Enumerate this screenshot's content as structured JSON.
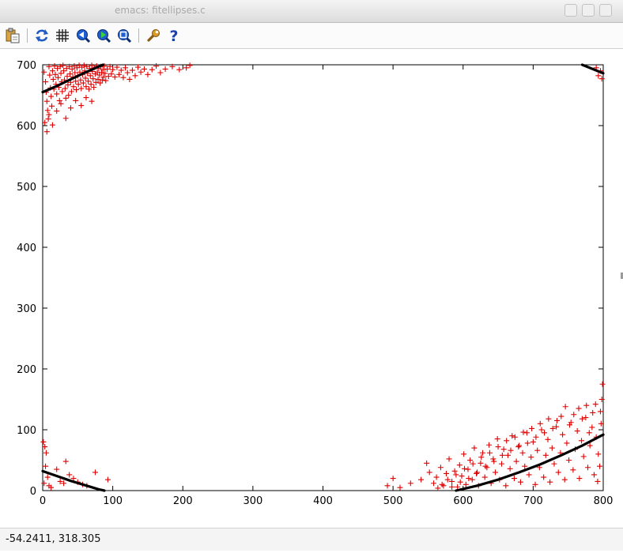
{
  "window": {
    "title": "emacs: fitellipses.c"
  },
  "toolbar": {
    "buttons": [
      {
        "icon": "copy-to-clipboard-icon",
        "label": "Copy to clipboard"
      },
      {
        "icon": "replot-icon",
        "label": "Replot"
      },
      {
        "icon": "grid-icon",
        "label": "Grid"
      },
      {
        "icon": "previous-zoom-icon",
        "label": "Previous zoom"
      },
      {
        "icon": "next-zoom-icon",
        "label": "Next zoom"
      },
      {
        "icon": "autoscale-icon",
        "label": "Autoscale"
      },
      {
        "icon": "settings-wrench-icon",
        "label": "Settings"
      },
      {
        "icon": "help-icon",
        "label": "Help"
      }
    ]
  },
  "status": {
    "readout": "-54.2411,  318.305"
  },
  "colors": {
    "points": "#e00000",
    "curves": "#000000",
    "axes": "#000000"
  },
  "chart_data": {
    "type": "scatter",
    "title": "",
    "xlabel": "",
    "ylabel": "",
    "xlim": [
      0,
      800
    ],
    "ylim": [
      0,
      700
    ],
    "xticks": [
      0,
      100,
      200,
      300,
      400,
      500,
      600,
      700,
      800
    ],
    "yticks": [
      0,
      100,
      200,
      300,
      400,
      500,
      600,
      700
    ],
    "grid": false,
    "legend": "none",
    "series": [
      {
        "marker": "+",
        "color": "#e00000",
        "points": [
          [
            2,
            688
          ],
          [
            4,
            672
          ],
          [
            5,
            655
          ],
          [
            6,
            640
          ],
          [
            7,
            625
          ],
          [
            8,
            611
          ],
          [
            9,
            697
          ],
          [
            10,
            683
          ],
          [
            11,
            662
          ],
          [
            12,
            648
          ],
          [
            13,
            632
          ],
          [
            14,
            690
          ],
          [
            15,
            676
          ],
          [
            16,
            660
          ],
          [
            17,
            698
          ],
          [
            18,
            684
          ],
          [
            19,
            668
          ],
          [
            20,
            652
          ],
          [
            21,
            694
          ],
          [
            22,
            679
          ],
          [
            23,
            663
          ],
          [
            24,
            641
          ],
          [
            25,
            697
          ],
          [
            26,
            686
          ],
          [
            27,
            672
          ],
          [
            28,
            656
          ],
          [
            29,
            699
          ],
          [
            30,
            690
          ],
          [
            31,
            675
          ],
          [
            32,
            661
          ],
          [
            33,
            645
          ],
          [
            34,
            694
          ],
          [
            35,
            681
          ],
          [
            36,
            667
          ],
          [
            37,
            650
          ],
          [
            38,
            697
          ],
          [
            39,
            685
          ],
          [
            40,
            671
          ],
          [
            41,
            656
          ],
          [
            42,
            693
          ],
          [
            43,
            680
          ],
          [
            44,
            664
          ],
          [
            45,
            698
          ],
          [
            46,
            687
          ],
          [
            47,
            673
          ],
          [
            48,
            659
          ],
          [
            49,
            695
          ],
          [
            50,
            682
          ],
          [
            51,
            668
          ],
          [
            52,
            699
          ],
          [
            53,
            688
          ],
          [
            54,
            675
          ],
          [
            55,
            661
          ],
          [
            56,
            696
          ],
          [
            57,
            684
          ],
          [
            58,
            670
          ],
          [
            59,
            699
          ],
          [
            60,
            690
          ],
          [
            61,
            678
          ],
          [
            62,
            664
          ],
          [
            63,
            697
          ],
          [
            64,
            686
          ],
          [
            65,
            673
          ],
          [
            66,
            660
          ],
          [
            67,
            694
          ],
          [
            68,
            682
          ],
          [
            69,
            668
          ],
          [
            70,
            699
          ],
          [
            71,
            689
          ],
          [
            72,
            677
          ],
          [
            73,
            663
          ],
          [
            74,
            696
          ],
          [
            75,
            685
          ],
          [
            76,
            671
          ],
          [
            77,
            698
          ],
          [
            78,
            688
          ],
          [
            79,
            676
          ],
          [
            80,
            694
          ],
          [
            81,
            683
          ],
          [
            82,
            670
          ],
          [
            83,
            697
          ],
          [
            84,
            687
          ],
          [
            85,
            675
          ],
          [
            86,
            692
          ],
          [
            87,
            680
          ],
          [
            88,
            698
          ],
          [
            89,
            686
          ],
          [
            90,
            674
          ],
          [
            92,
            693
          ],
          [
            94,
            681
          ],
          [
            96,
            697
          ],
          [
            98,
            685
          ],
          [
            100,
            692
          ],
          [
            103,
            680
          ],
          [
            106,
            696
          ],
          [
            109,
            684
          ],
          [
            112,
            691
          ],
          [
            115,
            679
          ],
          [
            118,
            695
          ],
          [
            121,
            687
          ],
          [
            124,
            676
          ],
          [
            128,
            691
          ],
          [
            132,
            682
          ],
          [
            136,
            696
          ],
          [
            140,
            688
          ],
          [
            145,
            693
          ],
          [
            150,
            684
          ],
          [
            156,
            692
          ],
          [
            162,
            698
          ],
          [
            168,
            687
          ],
          [
            175,
            693
          ],
          [
            185,
            697
          ],
          [
            195,
            692
          ],
          [
            205,
            695
          ],
          [
            210,
            699
          ],
          [
            3,
            605
          ],
          [
            6,
            590
          ],
          [
            9,
            618
          ],
          [
            14,
            601
          ],
          [
            20,
            624
          ],
          [
            26,
            636
          ],
          [
            33,
            612
          ],
          [
            40,
            629
          ],
          [
            47,
            641
          ],
          [
            55,
            633
          ],
          [
            62,
            646
          ],
          [
            70,
            640
          ],
          [
            1,
            80
          ],
          [
            3,
            72
          ],
          [
            5,
            62
          ],
          [
            4,
            40
          ],
          [
            7,
            22
          ],
          [
            2,
            12
          ],
          [
            9,
            8
          ],
          [
            12,
            5
          ],
          [
            20,
            35
          ],
          [
            25,
            15
          ],
          [
            30,
            12
          ],
          [
            33,
            48
          ],
          [
            38,
            26
          ],
          [
            44,
            20
          ],
          [
            50,
            14
          ],
          [
            57,
            10
          ],
          [
            63,
            8
          ],
          [
            75,
            30
          ],
          [
            93,
            18
          ],
          [
            492,
            8
          ],
          [
            500,
            20
          ],
          [
            510,
            5
          ],
          [
            525,
            12
          ],
          [
            540,
            18
          ],
          [
            548,
            45
          ],
          [
            552,
            30
          ],
          [
            558,
            12
          ],
          [
            562,
            22
          ],
          [
            568,
            38
          ],
          [
            572,
            8
          ],
          [
            576,
            28
          ],
          [
            580,
            52
          ],
          [
            584,
            15
          ],
          [
            588,
            32
          ],
          [
            592,
            6
          ],
          [
            595,
            42
          ],
          [
            598,
            24
          ],
          [
            601,
            60
          ],
          [
            604,
            10
          ],
          [
            607,
            35
          ],
          [
            610,
            50
          ],
          [
            613,
            18
          ],
          [
            616,
            70
          ],
          [
            619,
            28
          ],
          [
            622,
            8
          ],
          [
            625,
            45
          ],
          [
            628,
            62
          ],
          [
            631,
            22
          ],
          [
            634,
            38
          ],
          [
            637,
            75
          ],
          [
            640,
            12
          ],
          [
            643,
            52
          ],
          [
            646,
            30
          ],
          [
            649,
            85
          ],
          [
            652,
            18
          ],
          [
            655,
            44
          ],
          [
            658,
            68
          ],
          [
            661,
            8
          ],
          [
            664,
            58
          ],
          [
            667,
            36
          ],
          [
            670,
            90
          ],
          [
            673,
            20
          ],
          [
            676,
            48
          ],
          [
            679,
            72
          ],
          [
            682,
            14
          ],
          [
            685,
            62
          ],
          [
            688,
            40
          ],
          [
            691,
            95
          ],
          [
            694,
            26
          ],
          [
            697,
            55
          ],
          [
            700,
            80
          ],
          [
            703,
            10
          ],
          [
            706,
            66
          ],
          [
            709,
            38
          ],
          [
            712,
            100
          ],
          [
            715,
            22
          ],
          [
            718,
            58
          ],
          [
            721,
            84
          ],
          [
            724,
            14
          ],
          [
            727,
            70
          ],
          [
            730,
            44
          ],
          [
            733,
            105
          ],
          [
            736,
            30
          ],
          [
            739,
            62
          ],
          [
            742,
            92
          ],
          [
            745,
            18
          ],
          [
            748,
            78
          ],
          [
            751,
            50
          ],
          [
            754,
            112
          ],
          [
            757,
            34
          ],
          [
            760,
            68
          ],
          [
            763,
            98
          ],
          [
            766,
            20
          ],
          [
            769,
            82
          ],
          [
            772,
            56
          ],
          [
            775,
            120
          ],
          [
            778,
            38
          ],
          [
            781,
            74
          ],
          [
            784,
            104
          ],
          [
            787,
            26
          ],
          [
            790,
            88
          ],
          [
            793,
            60
          ],
          [
            796,
            130
          ],
          [
            798,
            150
          ],
          [
            799,
            175
          ],
          [
            797,
            110
          ],
          [
            795,
            40
          ],
          [
            792,
            15
          ],
          [
            789,
            142
          ],
          [
            785,
            128
          ],
          [
            780,
            95
          ],
          [
            776,
            140
          ],
          [
            770,
            118
          ],
          [
            765,
            135
          ],
          [
            758,
            125
          ],
          [
            752,
            108
          ],
          [
            746,
            138
          ],
          [
            740,
            122
          ],
          [
            734,
            115
          ],
          [
            728,
            102
          ],
          [
            722,
            118
          ],
          [
            716,
            95
          ],
          [
            710,
            110
          ],
          [
            704,
            88
          ],
          [
            698,
            102
          ],
          [
            692,
            78
          ],
          [
            686,
            96
          ],
          [
            680,
            74
          ],
          [
            674,
            88
          ],
          [
            668,
            66
          ],
          [
            662,
            82
          ],
          [
            656,
            58
          ],
          [
            650,
            72
          ],
          [
            644,
            48
          ],
          [
            638,
            62
          ],
          [
            632,
            40
          ],
          [
            626,
            55
          ],
          [
            620,
            30
          ],
          [
            614,
            44
          ],
          [
            608,
            20
          ],
          [
            602,
            36
          ],
          [
            596,
            14
          ],
          [
            590,
            26
          ],
          [
            584,
            6
          ],
          [
            578,
            18
          ],
          [
            570,
            10
          ],
          [
            564,
            4
          ],
          [
            790,
            695
          ],
          [
            793,
            682
          ],
          [
            796,
            690
          ],
          [
            798,
            677
          ]
        ]
      }
    ],
    "curves": [
      {
        "color": "#000000",
        "points": [
          [
            0,
            655
          ],
          [
            20,
            665
          ],
          [
            40,
            676
          ],
          [
            60,
            687
          ],
          [
            80,
            697
          ],
          [
            86,
            700
          ]
        ]
      },
      {
        "color": "#000000",
        "points": [
          [
            0,
            32
          ],
          [
            20,
            24
          ],
          [
            40,
            16
          ],
          [
            60,
            9
          ],
          [
            80,
            2
          ],
          [
            88,
            0
          ]
        ]
      },
      {
        "color": "#000000",
        "points": [
          [
            590,
            0
          ],
          [
            620,
            8
          ],
          [
            650,
            18
          ],
          [
            680,
            30
          ],
          [
            710,
            43
          ],
          [
            740,
            58
          ],
          [
            770,
            74
          ],
          [
            800,
            92
          ]
        ]
      },
      {
        "color": "#000000",
        "points": [
          [
            770,
            700
          ],
          [
            785,
            693
          ],
          [
            800,
            686
          ]
        ]
      }
    ]
  }
}
